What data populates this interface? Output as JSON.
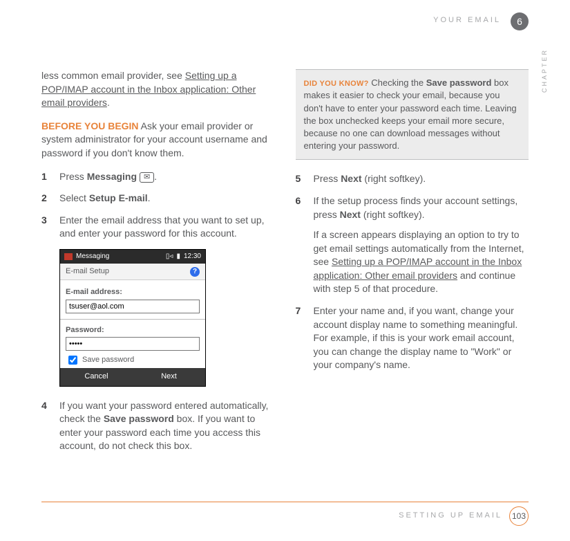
{
  "header": {
    "running": "YOUR EMAIL",
    "chapter_number": "6",
    "chapter_label": "CHAPTER"
  },
  "footer": {
    "section": "SETTING UP EMAIL",
    "page": "103"
  },
  "left": {
    "intro_a": "less common email provider, see ",
    "intro_link": "Setting up a POP/IMAP account in the Inbox application: Other email providers",
    "intro_b": ".",
    "before_label": "BEFORE YOU BEGIN",
    "before_text": "  Ask your email provider or system administrator for your account username and password if you don't know them.",
    "steps": {
      "s1_a": "Press ",
      "s1_bold": "Messaging",
      "s1_icon": "✉",
      "s1_b": ".",
      "s2_a": "Select ",
      "s2_bold": "Setup E-mail",
      "s2_b": ".",
      "s3": "Enter the email address that you want to set up, and enter your password for this account.",
      "s4_a": "If you want your password entered automatically, check the ",
      "s4_bold": "Save password",
      "s4_b": " box. If you want to enter your password each time you access this account, do not check this box."
    },
    "phone": {
      "bar_title": "Messaging",
      "bar_time": "12:30",
      "screen_title": "E-mail Setup",
      "label_email": "E-mail address:",
      "value_email": "tsuser@aol.com",
      "label_pw": "Password:",
      "value_pw": "•••••",
      "chk": "Save password",
      "soft_left": "Cancel",
      "soft_right": "Next"
    }
  },
  "right": {
    "callout_lead": "DID YOU KNOW?",
    "callout_a": "  Checking the ",
    "callout_bold": "Save password",
    "callout_b": " box makes it easier to check your email, because you don't have to enter your password each time. Leaving the box unchecked keeps your email more secure, because no one can download messages without entering your password.",
    "steps": {
      "s5_a": "Press ",
      "s5_bold": "Next",
      "s5_b": " (right softkey).",
      "s6_a": "If the setup process finds your account settings, press ",
      "s6_bold": "Next",
      "s6_b": " (right softkey).",
      "s6_p2_a": "If a screen appears displaying an option to try to get email settings automatically from the Internet, see ",
      "s6_link": "Setting up a POP/IMAP account in the Inbox application: Other email providers",
      "s6_p2_b": " and continue with step 5 of that procedure.",
      "s7": "Enter your name and, if you want, change your account display name to something meaningful. For example, if this is your work email account, you can change the display name to \"Work\" or your company's name."
    }
  }
}
